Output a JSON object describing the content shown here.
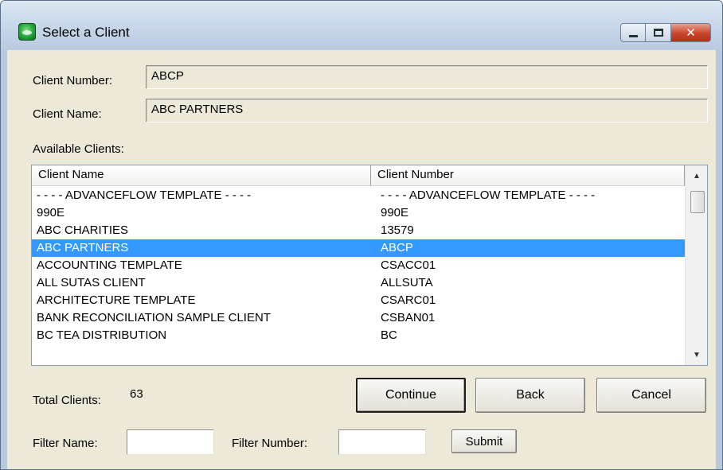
{
  "window": {
    "title": "Select a Client",
    "minimize_icon": "minimize-icon",
    "maximize_icon": "maximize-icon",
    "close_icon": "close-icon",
    "close_glyph": "✕"
  },
  "form": {
    "client_number_label": "Client Number:",
    "client_number_value": "ABCP",
    "client_name_label": "Client Name:",
    "client_name_value": "ABC PARTNERS",
    "available_label": "Available Clients:"
  },
  "list": {
    "columns": [
      "Client Name",
      "Client Number"
    ],
    "rows": [
      {
        "name": "- - - - ADVANCEFLOW TEMPLATE - - - -",
        "number": "- - - - ADVANCEFLOW TEMPLATE - - - -"
      },
      {
        "name": "990E",
        "number": "990E"
      },
      {
        "name": "ABC CHARITIES",
        "number": "13579"
      },
      {
        "name": "ABC PARTNERS",
        "number": "ABCP"
      },
      {
        "name": "ACCOUNTING TEMPLATE",
        "number": "CSACC01"
      },
      {
        "name": "ALL SUTAS CLIENT",
        "number": "ALLSUTA"
      },
      {
        "name": "ARCHITECTURE TEMPLATE",
        "number": "CSARC01"
      },
      {
        "name": "BANK RECONCILIATION SAMPLE CLIENT",
        "number": "CSBAN01"
      },
      {
        "name": "BC TEA DISTRIBUTION",
        "number": "BC"
      }
    ],
    "selected_index": 3,
    "scroll_up_glyph": "▲",
    "scroll_down_glyph": "▼",
    "selection_color": "#3399ff"
  },
  "footer": {
    "total_label": "Total Clients:",
    "total_value": "63",
    "continue_label": "Continue",
    "back_label": "Back",
    "cancel_label": "Cancel",
    "filter_name_label": "Filter Name:",
    "filter_name_value": "",
    "filter_number_label": "Filter Number:",
    "filter_number_value": "",
    "submit_label": "Submit"
  }
}
